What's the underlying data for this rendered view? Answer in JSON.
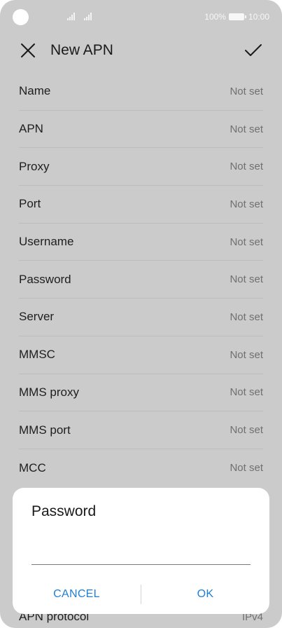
{
  "status_bar": {
    "battery_percent": "100%",
    "time": "10:00",
    "colors": {
      "text": "#f7f7f7"
    }
  },
  "header": {
    "title": "New APN",
    "close_icon": "close-icon",
    "confirm_icon": "check-icon"
  },
  "settings": [
    {
      "label": "Name",
      "value": "Not set"
    },
    {
      "label": "APN",
      "value": "Not set"
    },
    {
      "label": "Proxy",
      "value": "Not set"
    },
    {
      "label": "Port",
      "value": "Not set"
    },
    {
      "label": "Username",
      "value": "Not set"
    },
    {
      "label": "Password",
      "value": "Not set"
    },
    {
      "label": "Server",
      "value": "Not set"
    },
    {
      "label": "MMSC",
      "value": "Not set"
    },
    {
      "label": "MMS proxy",
      "value": "Not set"
    },
    {
      "label": "MMS port",
      "value": "Not set"
    },
    {
      "label": "MCC",
      "value": "Not set"
    }
  ],
  "partially_visible_row": {
    "label": "APN protocol",
    "value": "IPv4"
  },
  "dialog": {
    "title": "Password",
    "input_value": "",
    "cancel_label": "CANCEL",
    "ok_label": "OK",
    "accent_color": "#1f7fd6"
  },
  "colors": {
    "dim_background": "#cbcbcb",
    "dialog_background": "#ffffff"
  }
}
